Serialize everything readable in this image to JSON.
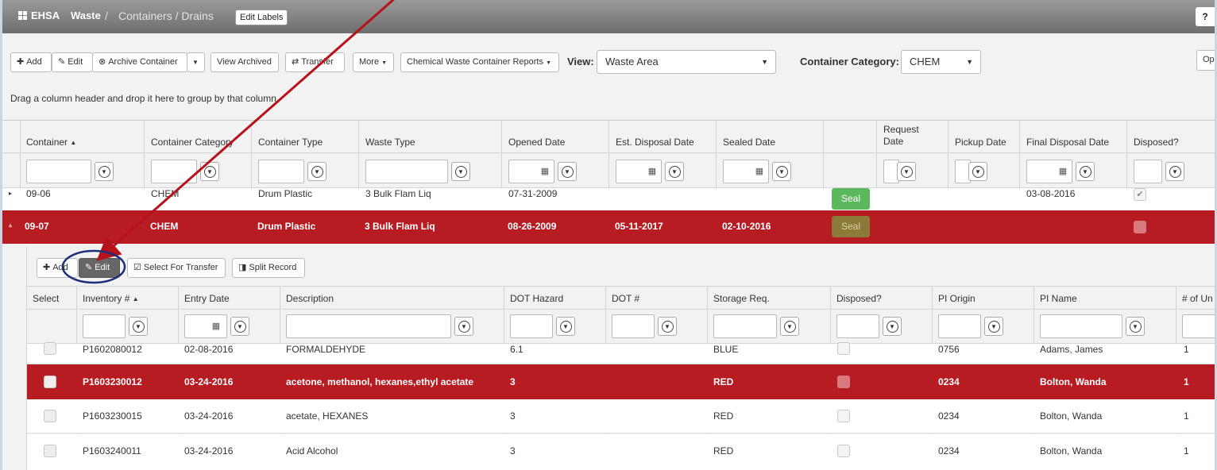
{
  "header": {
    "brand": "EHSA",
    "breadcrumb": [
      "Waste",
      "/",
      "Containers / Drains"
    ],
    "edit_labels": "Edit Labels",
    "help": "?"
  },
  "toolbar": {
    "add": "Add",
    "edit": "Edit",
    "archive": "Archive Container",
    "view_archived": "View Archived",
    "transfer": "Transfer",
    "more": "More",
    "reports": "Chemical Waste Container Reports",
    "view_label": "View:",
    "view_value": "Waste Area",
    "category_label": "Container Category:",
    "category_value": "CHEM",
    "right_btn": "Op"
  },
  "grid": {
    "drag_hint": "Drag a column header and drop it here to group by that column",
    "columns": [
      "Container",
      "Container Category",
      "Container Type",
      "Waste Type",
      "Opened Date",
      "Est. Disposal Date",
      "Sealed Date",
      "",
      "Request Date",
      "Pickup Date",
      "Final Disposal Date",
      "Disposed?"
    ],
    "sort_indicator": "▲",
    "rows": [
      {
        "container": "09-06",
        "category": "CHEM",
        "type": "Drum Plastic",
        "waste": "3 Bulk Flam Liq",
        "opened": "07-31-2009",
        "est": "",
        "sealed": "",
        "seal": "Seal",
        "request": "",
        "pickup": "",
        "final": "03-08-2016",
        "disposed": true
      },
      {
        "container": "09-07",
        "category": "CHEM",
        "type": "Drum Plastic",
        "waste": "3 Bulk Flam Liq",
        "opened": "08-26-2009",
        "est": "05-11-2017",
        "sealed": "02-10-2016",
        "seal": "Seal",
        "request": "",
        "pickup": "",
        "final": "",
        "disposed": false
      }
    ]
  },
  "detail": {
    "toolbar": {
      "add": "Add",
      "edit": "Edit",
      "select_transfer": "Select For Transfer",
      "split": "Split Record"
    },
    "columns": [
      "Select",
      "Inventory #",
      "Entry Date",
      "Description",
      "DOT Hazard",
      "DOT #",
      "Storage Req.",
      "Disposed?",
      "PI Origin",
      "PI Name",
      "# of Un"
    ],
    "rows": [
      {
        "inventory": "P1602080012",
        "entry": "02-08-2016",
        "description": "FORMALDEHYDE",
        "hazard": "6.1",
        "dot": "",
        "storage": "BLUE",
        "origin": "0756",
        "pi": "Adams, James",
        "units": "1"
      },
      {
        "inventory": "P1603230012",
        "entry": "03-24-2016",
        "description": "acetone, methanol, hexanes,ethyl acetate",
        "hazard": "3",
        "dot": "",
        "storage": "RED",
        "origin": "0234",
        "pi": "Bolton, Wanda",
        "units": "1"
      },
      {
        "inventory": "P1603230015",
        "entry": "03-24-2016",
        "description": "acetate, HEXANES",
        "hazard": "3",
        "dot": "",
        "storage": "RED",
        "origin": "0234",
        "pi": "Bolton, Wanda",
        "units": "1"
      },
      {
        "inventory": "P1603240011",
        "entry": "03-24-2016",
        "description": "Acid Alcohol",
        "hazard": "3",
        "dot": "",
        "storage": "RED",
        "origin": "0234",
        "pi": "Bolton, Wanda",
        "units": "1"
      }
    ]
  },
  "colors": {
    "row_selected": "#b81c23",
    "seal_green": "#5cb85c",
    "seal_olive": "#8b7a3a",
    "annotation_arrow": "#b5121b",
    "annotation_circle": "#1d2e7a"
  }
}
